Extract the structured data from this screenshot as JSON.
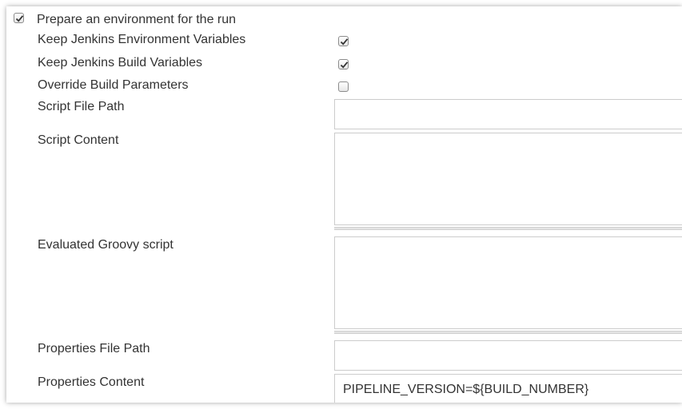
{
  "section": {
    "title": "Prepare an environment for the run",
    "checked": true
  },
  "fields": {
    "keep_env_vars": {
      "label": "Keep Jenkins Environment Variables",
      "checked": true
    },
    "keep_build_vars": {
      "label": "Keep Jenkins Build Variables",
      "checked": true
    },
    "override_params": {
      "label": "Override Build Parameters",
      "checked": false
    },
    "script_file_path": {
      "label": "Script File Path",
      "value": ""
    },
    "script_content": {
      "label": "Script Content",
      "value": ""
    },
    "groovy_script": {
      "label": "Evaluated Groovy script",
      "value": ""
    },
    "properties_file_path": {
      "label": "Properties File Path",
      "value": ""
    },
    "properties_content": {
      "label": "Properties Content",
      "value": "PIPELINE_VERSION=${BUILD_NUMBER}"
    }
  },
  "icons": {
    "checkbox_checked": "checkmark-icon"
  }
}
